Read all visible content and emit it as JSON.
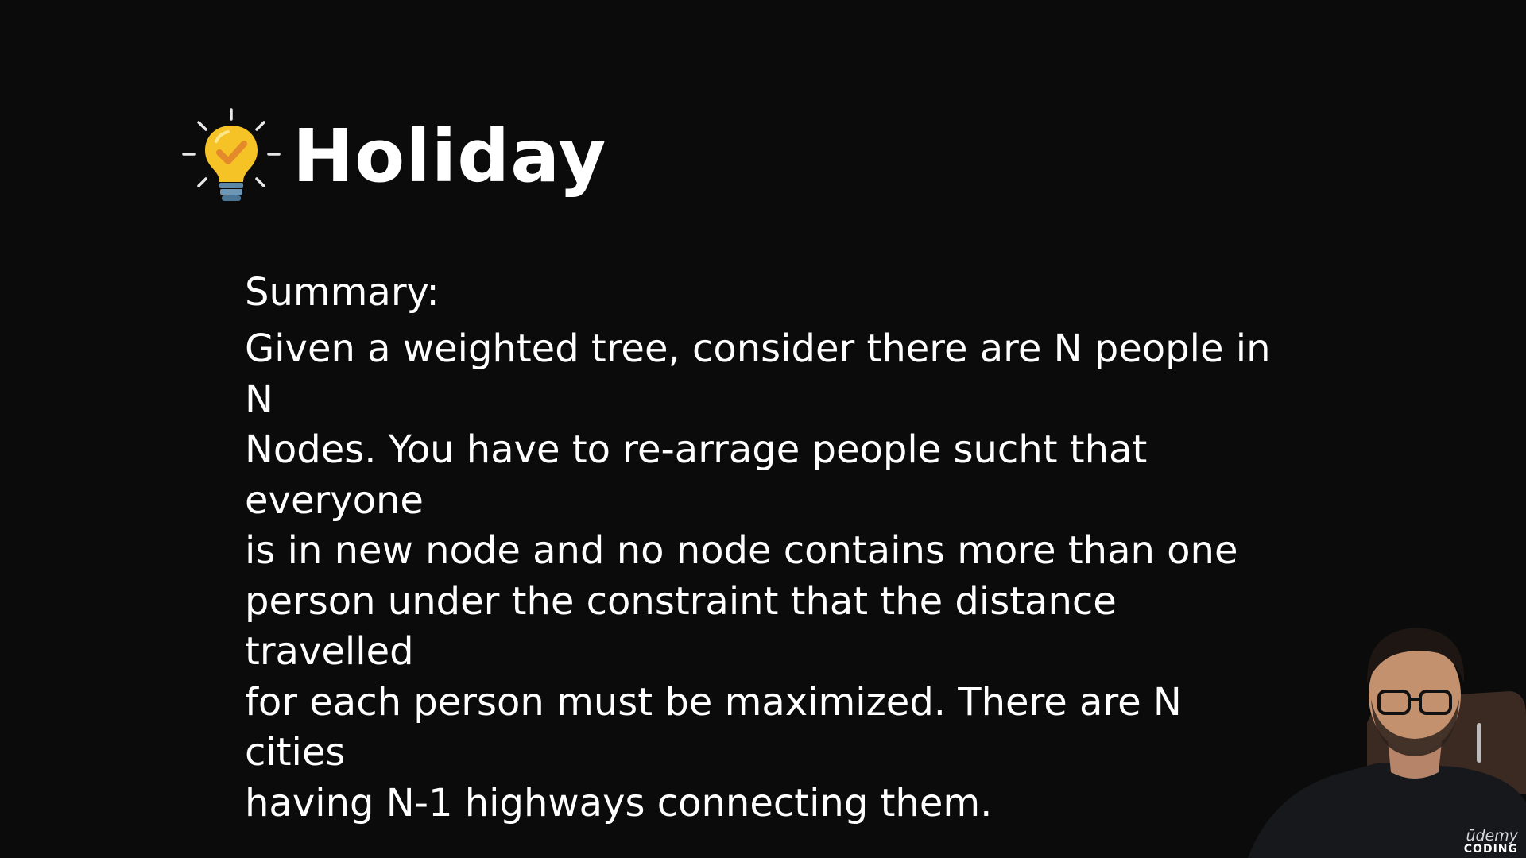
{
  "slide": {
    "title": "Holiday",
    "title_icon": "lightbulb-check-icon",
    "summary_label": "Summary:",
    "summary_lines": [
      "Given a weighted tree, consider there are N people in N",
      "Nodes. You have to re-arrage people sucht that everyone",
      "is in new node and no node contains more than one",
      "person under the constraint that the distance travelled",
      "for each person must be maximized. There are N cities",
      "having N-1 highways connecting them."
    ]
  },
  "badge": {
    "top": "ūdemy",
    "bottom": "CODING"
  },
  "colors": {
    "background": "#0b0b0b",
    "text": "#ffffff",
    "bulb": "#f5c326",
    "check": "#e58a2a",
    "bulb_base": "#5b86a6"
  }
}
